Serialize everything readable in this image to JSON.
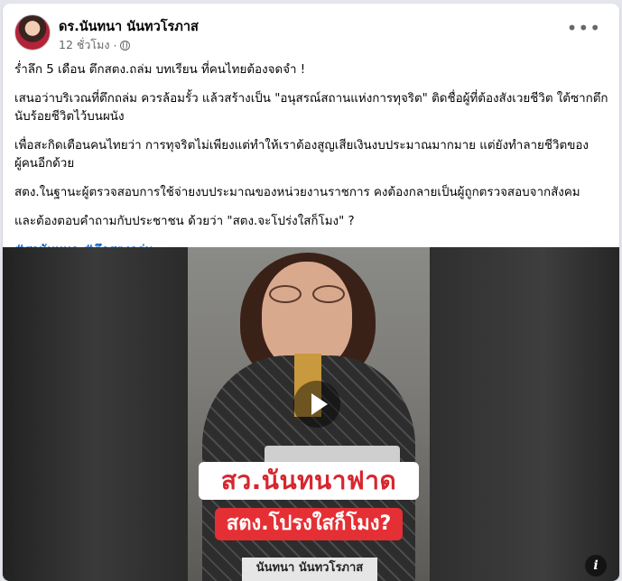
{
  "post": {
    "author": "ดร.นันทนา นันทวโรภาส",
    "time": "12 ชั่วโมง",
    "separator": "·",
    "paragraphs": [
      "ร่ำลึก 5 เดือน ตึกสตง.ถล่ม บทเรียน ที่คนไทยต้องจดจำ !",
      "เสนอว่าบริเวณที่ตึกถล่ม ควรล้อมรั้ว แล้วสร้างเป็น \"อนุสรณ์สถานแห่งการทุจริต\" ติดชื่อผู้ที่ต้องสังเวยชีวิต ใต้ซากตึก นับร้อยชีวิตไว้บนผนัง",
      "เพื่อสะกิดเตือนคนไทยว่า การทุจริตไม่เพียงแต่ทำให้เราต้องสูญเสียเงินงบประมาณมากมาย แต่ยังทำลายชีวิตของผู้คนอีกด้วย",
      "สตง.ในฐานะผู้ตรวจสอบการใช้จ่ายงบประมาณของหน่วยงานราชการ คงต้องกลายเป็นผู้ถูกตรวจสอบจากสังคม",
      "และต้องตอบคำถามกับประชาชน ด้วยว่า \"สตง.จะโปร่งใสก็โมง\" ?"
    ],
    "hashtags": [
      "#สวนันทนา",
      "#ตึกสตงถล่ม"
    ]
  },
  "video": {
    "caption_title": "สว.นันทนาฟาด",
    "caption_question": "สตง.โปรงใสก็โมง?",
    "caption_name": "นันทนา นันทวโรภาส",
    "info_label": "i"
  },
  "icons": {
    "more": "more-options-icon",
    "globe": "public-globe-icon",
    "play": "play-icon"
  },
  "colors": {
    "hashtag": "#1467c9",
    "caption_red": "#e42f34"
  }
}
